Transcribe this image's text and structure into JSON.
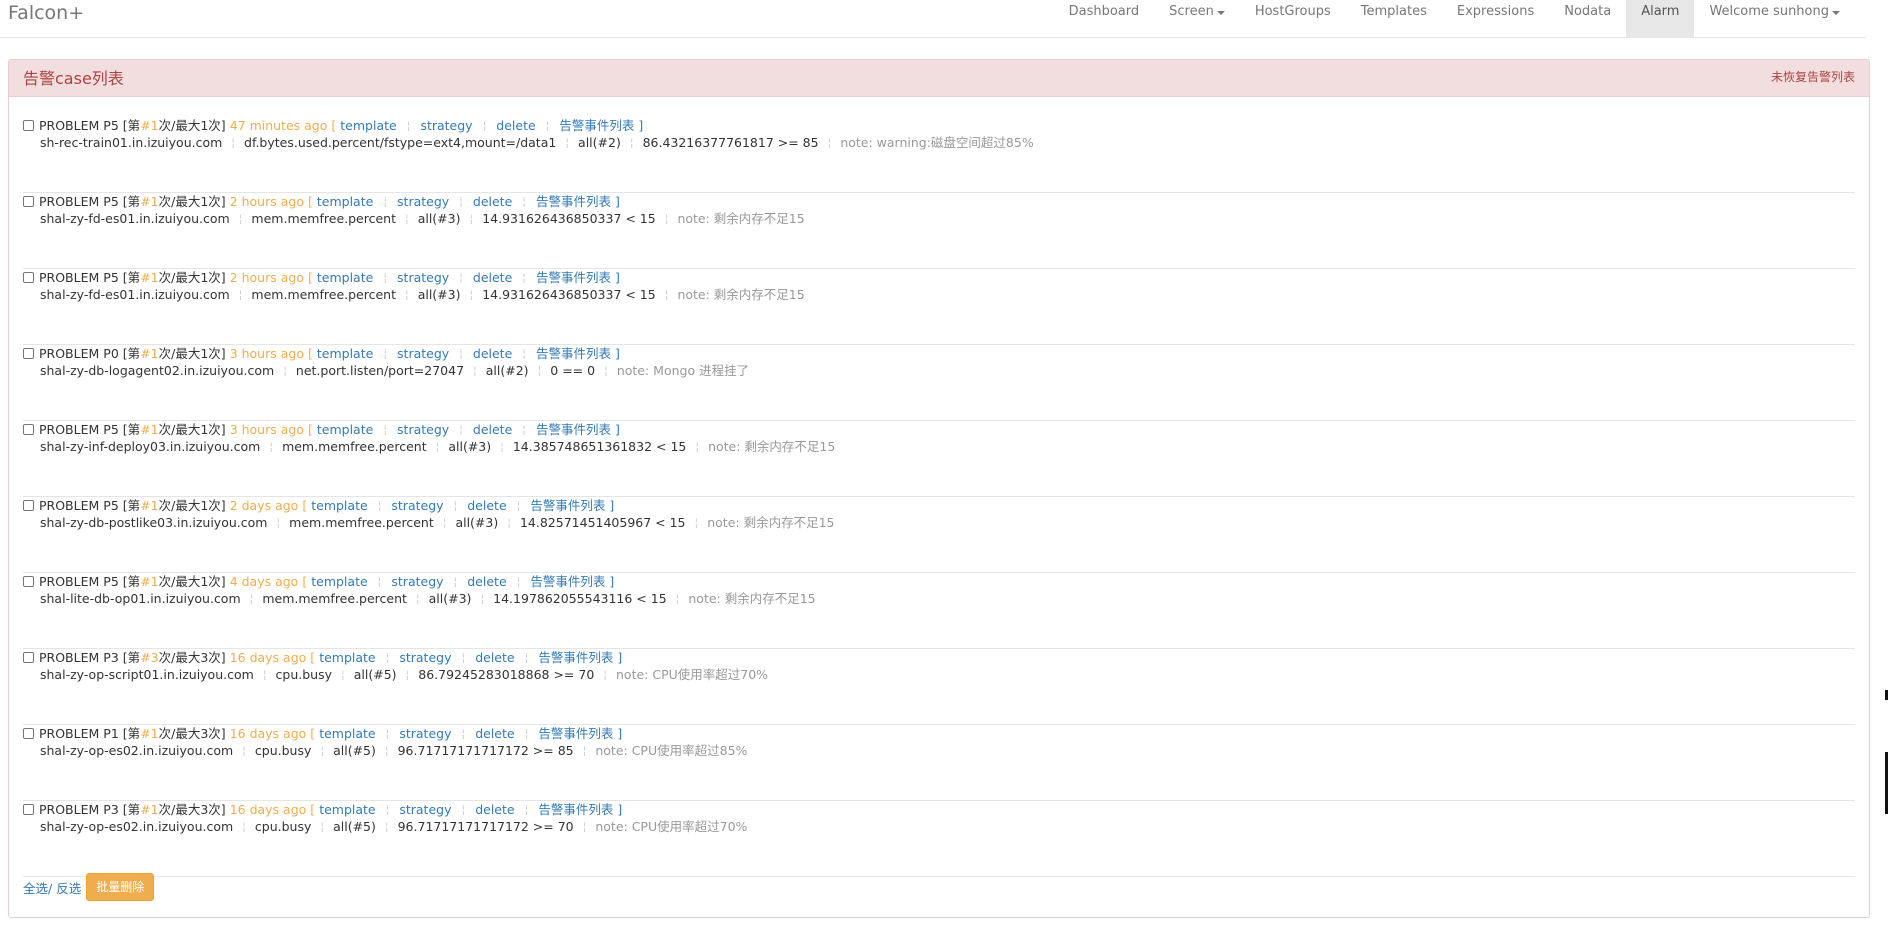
{
  "brand": "Falcon+",
  "nav": {
    "dashboard": "Dashboard",
    "screen": "Screen",
    "hostgroups": "HostGroups",
    "templates": "Templates",
    "expressions": "Expressions",
    "nodata": "Nodata",
    "alarm": "Alarm",
    "welcome": "Welcome sunhong"
  },
  "panel": {
    "title": "告警case列表",
    "link": "未恢复告警列表"
  },
  "row_labels": {
    "count_prefix": "[第",
    "count_mid": "次/最大",
    "count_suffix": "次]",
    "bracket_open": "[",
    "bracket_close": "]",
    "template": "template",
    "strategy": "strategy",
    "delete": "delete",
    "events": "告警事件列表",
    "sep": "¦"
  },
  "alarms": [
    {
      "status": "PROBLEM",
      "priority": "P5",
      "current": "#1",
      "max": "1",
      "time": "47 minutes ago",
      "host": "sh-rec-train01.in.izuiyou.com",
      "metric": "df.bytes.used.percent/fstype=ext4,mount=/data1",
      "func": "all(#2)",
      "condition": "86.43216377761817 >= 85",
      "note": "note: warning:磁盘空间超过85%"
    },
    {
      "status": "PROBLEM",
      "priority": "P5",
      "current": "#1",
      "max": "1",
      "time": "2 hours ago",
      "host": "shal-zy-fd-es01.in.izuiyou.com",
      "metric": "mem.memfree.percent",
      "func": "all(#3)",
      "condition": "14.931626436850337 < 15",
      "note": "note: 剩余内存不足15"
    },
    {
      "status": "PROBLEM",
      "priority": "P5",
      "current": "#1",
      "max": "1",
      "time": "2 hours ago",
      "host": "shal-zy-fd-es01.in.izuiyou.com",
      "metric": "mem.memfree.percent",
      "func": "all(#3)",
      "condition": "14.931626436850337 < 15",
      "note": "note: 剩余内存不足15"
    },
    {
      "status": "PROBLEM",
      "priority": "P0",
      "current": "#1",
      "max": "1",
      "time": "3 hours ago",
      "host": "shal-zy-db-logagent02.in.izuiyou.com",
      "metric": "net.port.listen/port=27047",
      "func": "all(#2)",
      "condition": "0 == 0",
      "note": "note: Mongo 进程挂了"
    },
    {
      "status": "PROBLEM",
      "priority": "P5",
      "current": "#1",
      "max": "1",
      "time": "3 hours ago",
      "host": "shal-zy-inf-deploy03.in.izuiyou.com",
      "metric": "mem.memfree.percent",
      "func": "all(#3)",
      "condition": "14.385748651361832 < 15",
      "note": "note: 剩余内存不足15"
    },
    {
      "status": "PROBLEM",
      "priority": "P5",
      "current": "#1",
      "max": "1",
      "time": "2 days ago",
      "host": "shal-zy-db-postlike03.in.izuiyou.com",
      "metric": "mem.memfree.percent",
      "func": "all(#3)",
      "condition": "14.82571451405967 < 15",
      "note": "note: 剩余内存不足15"
    },
    {
      "status": "PROBLEM",
      "priority": "P5",
      "current": "#1",
      "max": "1",
      "time": "4 days ago",
      "host": "shal-lite-db-op01.in.izuiyou.com",
      "metric": "mem.memfree.percent",
      "func": "all(#3)",
      "condition": "14.197862055543116 < 15",
      "note": "note: 剩余内存不足15"
    },
    {
      "status": "PROBLEM",
      "priority": "P3",
      "current": "#3",
      "max": "3",
      "time": "16 days ago",
      "host": "shal-zy-op-script01.in.izuiyou.com",
      "metric": "cpu.busy",
      "func": "all(#5)",
      "condition": "86.79245283018868 >= 70",
      "note": "note: CPU使用率超过70%"
    },
    {
      "status": "PROBLEM",
      "priority": "P1",
      "current": "#1",
      "max": "3",
      "time": "16 days ago",
      "host": "shal-zy-op-es02.in.izuiyou.com",
      "metric": "cpu.busy",
      "func": "all(#5)",
      "condition": "96.71717171717172 >= 85",
      "note": "note: CPU使用率超过85%"
    },
    {
      "status": "PROBLEM",
      "priority": "P3",
      "current": "#1",
      "max": "3",
      "time": "16 days ago",
      "host": "shal-zy-op-es02.in.izuiyou.com",
      "metric": "cpu.busy",
      "func": "all(#5)",
      "condition": "96.71717171717172 >= 70",
      "note": "note: CPU使用率超过70%"
    }
  ],
  "footer": {
    "select_all": "全选/",
    "invert": "反选",
    "batch_delete": "批量删除"
  }
}
